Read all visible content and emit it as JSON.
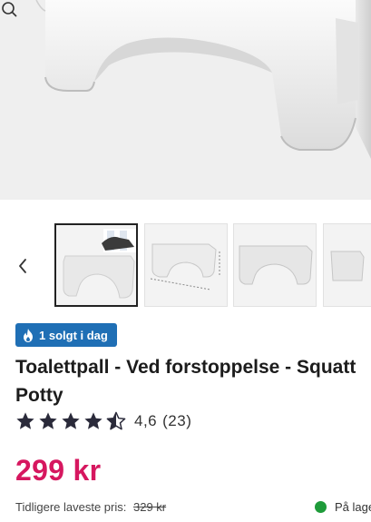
{
  "gallery": {
    "prev_icon": "chevron-left-icon",
    "zoom_icon": "zoom-icon",
    "thumbnail_count_visible": 4
  },
  "badge": {
    "icon": "flame-icon",
    "label": "1 solgt i dag",
    "color": "#1f6fb5"
  },
  "product": {
    "title_line1": "Toalettpall - Ved forstoppelse - Squatt",
    "title_line2": "Potty",
    "rating_value": "4,6",
    "rating_count": "(23)",
    "stars": 4.5,
    "price": "299 kr",
    "price_color": "#d6175f",
    "previous_price_label": "Tidligere laveste pris:",
    "previous_price": "329 kr",
    "stock_label": "På lage",
    "stock_color": "#1e9b3a"
  }
}
